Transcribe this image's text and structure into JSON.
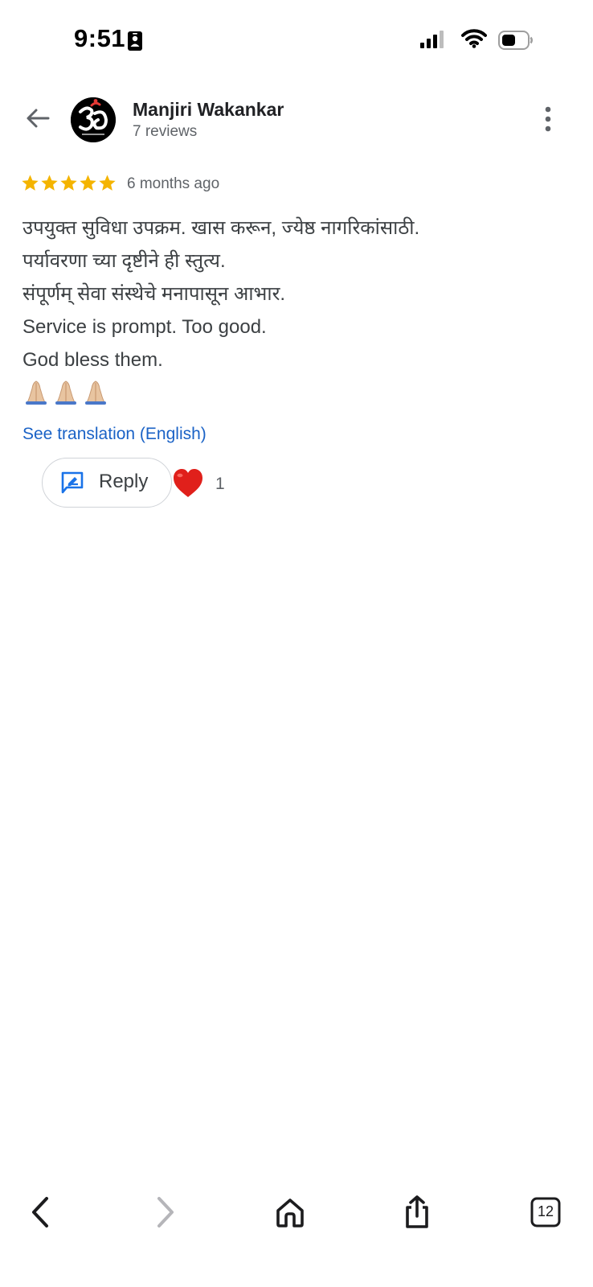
{
  "status_bar": {
    "time": "9:51",
    "icons": [
      "contact-card-icon",
      "cellular-signal-icon",
      "wifi-icon",
      "battery-icon"
    ]
  },
  "header": {
    "reviewer_name": "Manjiri Wakankar",
    "review_count": "7 reviews",
    "avatar_icon": "om-symbol-avatar",
    "back_icon": "back-arrow-icon",
    "menu_icon": "more-vert-icon"
  },
  "review": {
    "rating": 5,
    "rating_max": 5,
    "star_color": "#F4B400",
    "time_ago": "6 months ago",
    "lines": [
      "उपयुक्त सुविधा उपक्रम. खास करून, ज्येष्ठ नागरिकांसाठी.",
      "पर्यावरणा च्या दृष्टीने ही स्तुत्य.",
      "संपूर्णम् सेवा संस्थेचे मनापासून आभार.",
      "Service is prompt. Too good.",
      "God bless them."
    ],
    "emoji": [
      "🙏🏼",
      "🙏🏼",
      "🙏🏼"
    ],
    "translate_link": "See translation (English)"
  },
  "actions": {
    "reply_label": "Reply",
    "reaction_emoji": "❤️",
    "reaction_count": "1"
  },
  "toolbar": {
    "items": [
      "back-chevron-icon",
      "forward-chevron-icon",
      "home-icon",
      "share-icon",
      "tabs-icon"
    ],
    "tabs_count": "12"
  },
  "colors": {
    "link": "#1A62C6",
    "accent_blue": "#1A73E8",
    "text_primary": "#202124",
    "text_secondary": "#5F6368"
  }
}
